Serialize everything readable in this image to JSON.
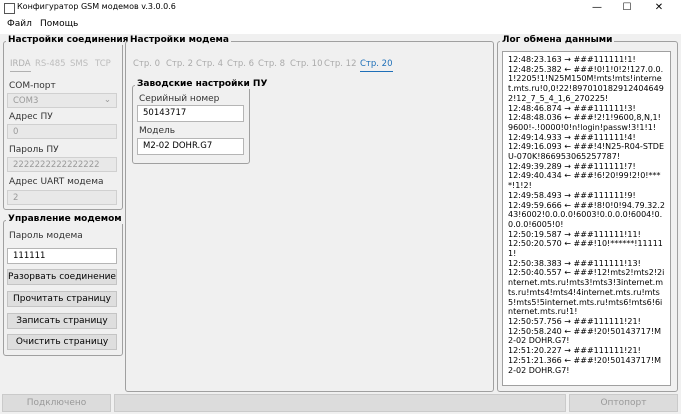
{
  "window": {
    "title": "Конфигуратор GSM модемов v.3.0.0.6",
    "minimize_glyph": "—",
    "maximize_glyph": "☐",
    "close_glyph": "✕"
  },
  "menu": {
    "file": "Файл",
    "help": "Помощь"
  },
  "connection": {
    "title": "Настройки соединения",
    "tabs": [
      "IRDA",
      "RS-485",
      "SMS",
      "TCP"
    ],
    "com_port_label": "COM-порт",
    "com_port_value": "COM3",
    "address_label": "Адрес ПУ",
    "address_value": "0",
    "password_label": "Пароль ПУ",
    "password_value": "2222222222222222",
    "uart_label": "Адрес UART модема",
    "uart_value": "2"
  },
  "modem_control": {
    "title": "Управление модемом",
    "password_label": "Пароль модема",
    "password_value": "111111",
    "buttons": {
      "disconnect": "Разорвать соединение",
      "read": "Прочитать страницу",
      "write": "Записать страницу",
      "clear": "Очистить страницу"
    }
  },
  "modem_settings": {
    "title": "Настройки модема",
    "pages": [
      "Стр. 0",
      "Стр. 2",
      "Стр. 4",
      "Стр. 6",
      "Стр. 8",
      "Стр. 10",
      "Стр. 12",
      "Стр. 20"
    ],
    "active_page": "Стр. 20",
    "factory": {
      "title": "Заводские настройки ПУ",
      "serial_label": "Серийный номер",
      "serial_value": "50143717",
      "model_label": "Модель",
      "model_value": "M2-02 DOHR.G7"
    }
  },
  "log": {
    "title": "Лог обмена данными",
    "text": "12:48:23.163 → ###111111!1!\n12:48:25.382 ← ###!0!1!0!2!127.0.0.1!2205!1!N25M150M!mts!mts!internet.mts.ru!0,0!22!8970101829124046492!12_7_5_4_1,6_270225!\n12:48:46.874 → ###111111!3!\n12:48:48.036 ← ###!2!1!9600,8,N,1!9600!-.!0000!0!n!login!passw!3!1!1!\n12:49:14.933 → ###111111!4!\n12:49:16.093 ← ###!4!N25-R04-STDEU-070K!866953065257787!\n12:49:39.289 → ###111111!7!\n12:49:40.434 ← ###!6!20!99!2!0!****!1!2!\n12:49:58.493 → ###111111!9!\n12:49:59.666 ← ###!8!0!0!94.79.32.243!6002!0.0.0.0!6003!0.0.0.0!6004!0.0.0.0!6005!0!\n12:50:19.587 → ###111111!11!\n12:50:20.570 ← ###!10!******!111111!\n12:50:38.383 → ###111111!13!\n12:50:40.557 ← ###!12!mts2!mts2!2internet.mts.ru!mts3!mts3!3internet.mts.ru!mts4!mts4!4internet.mts.ru!mts5!mts5!5internet.mts.ru!mts6!mts6!6internet.mts.ru!1!\n12:50:57.756 → ###111111!21!\n12:50:58.240 ← ###!20!50143717!M2-02 DOHR.G7!\n12:51:20.227 → ###111111!21!\n12:51:21.366 ← ###!20!50143717!M2-02 DOHR.G7!"
  },
  "status": {
    "connection": "Подключено",
    "right": "Оптопорт"
  },
  "icons": {
    "app": "app-icon",
    "dropdown": "chevron-down-icon"
  }
}
